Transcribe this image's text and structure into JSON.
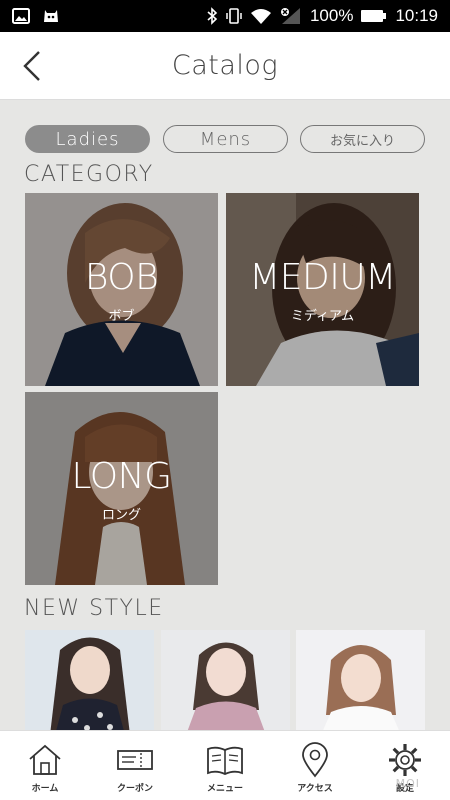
{
  "status_bar": {
    "battery": "100%",
    "time": "10:19"
  },
  "header": {
    "title": "Catalog"
  },
  "tabs": [
    {
      "label": "Ladies",
      "active": true
    },
    {
      "label": "Mens",
      "active": false
    },
    {
      "label": "お気に入り",
      "active": false
    }
  ],
  "category": {
    "heading": "CATEGORY",
    "items": [
      {
        "en": "BOB",
        "ja": "ボブ"
      },
      {
        "en": "MEDIUM",
        "ja": "ミディアム"
      },
      {
        "en": "LONG",
        "ja": "ロング"
      }
    ]
  },
  "new_style": {
    "heading": "NEW STYLE"
  },
  "bottom_nav": [
    {
      "label": "ホーム",
      "icon": "home-icon"
    },
    {
      "label": "クーポン",
      "icon": "coupon-icon"
    },
    {
      "label": "メニュー",
      "icon": "menu-book-icon"
    },
    {
      "label": "アクセス",
      "icon": "map-pin-icon"
    },
    {
      "label": "設定",
      "icon": "gear-icon"
    }
  ],
  "watermark": "MOI"
}
